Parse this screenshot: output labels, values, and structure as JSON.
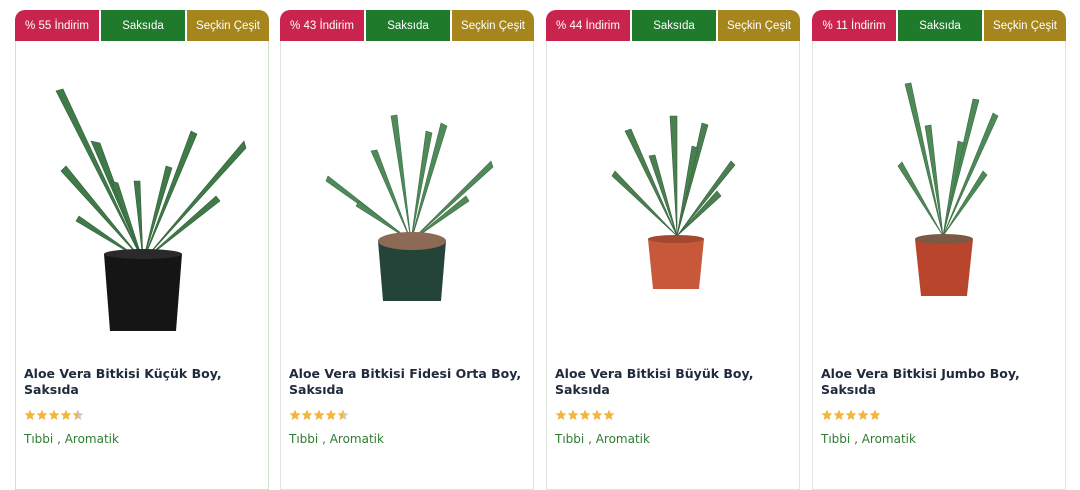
{
  "colors": {
    "discount_badge": "#c8244d",
    "stock_badge": "#1f7a2c",
    "select_badge": "#a6861c",
    "tag_text": "#2e7d32",
    "star": "#f4b63a"
  },
  "products": [
    {
      "discount": "% 55 İndirim",
      "stock": "Saksıda",
      "select": "Seçkin Çeşit",
      "title": "Aloe Vera Bitkisi Küçük Boy, Saksıda",
      "rating": 4.5,
      "tag1": "Tıbbi",
      "separator": ",",
      "tag2": "Aromatik",
      "pot_color": "#151515",
      "image": "aloe-vera-small-black-pot"
    },
    {
      "discount": "% 43 İndirim",
      "stock": "Saksıda",
      "select": "Seçkin Çeşit",
      "title": "Aloe Vera Bitkisi Fidesi Orta Boy, Saksıda",
      "rating": 4.5,
      "tag1": "Tıbbi",
      "separator": ",",
      "tag2": "Aromatik",
      "pot_color": "#24443a",
      "image": "aloe-vera-medium-green-pot"
    },
    {
      "discount": "% 44 İndirim",
      "stock": "Saksıda",
      "select": "Seçkin Çeşit",
      "title": "Aloe Vera Bitkisi Büyük Boy, Saksıda",
      "rating": 5,
      "tag1": "Tıbbi",
      "separator": ",",
      "tag2": "Aromatik",
      "pot_color": "#c8583a",
      "image": "aloe-vera-large-terracotta-pot"
    },
    {
      "discount": "% 11 İndirim",
      "stock": "Saksıda",
      "select": "Seçkin Çeşit",
      "title": "Aloe Vera Bitkisi Jumbo Boy, Saksıda",
      "rating": 5,
      "tag1": "Tıbbi",
      "separator": ",",
      "tag2": "Aromatik",
      "pot_color": "#b8452c",
      "image": "aloe-vera-jumbo-terracotta-pot"
    }
  ]
}
